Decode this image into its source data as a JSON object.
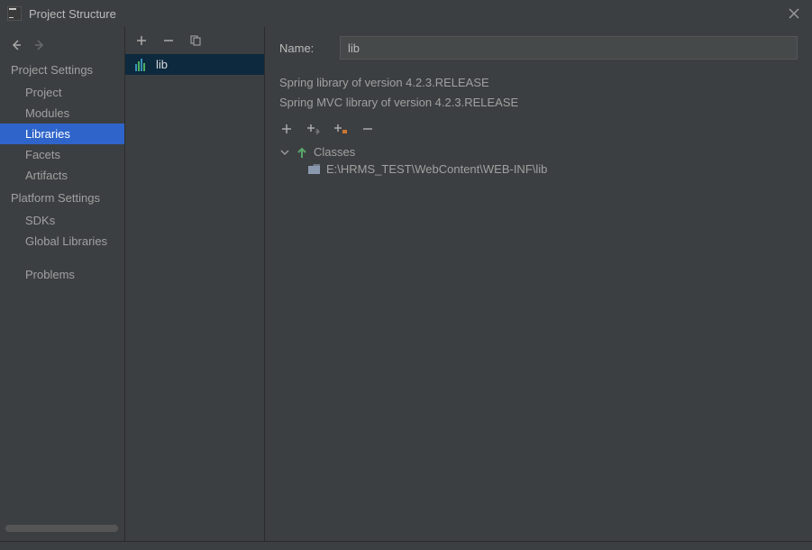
{
  "window": {
    "title": "Project Structure"
  },
  "sidebar": {
    "sections": [
      {
        "label": "Project Settings",
        "items": [
          {
            "label": "Project",
            "name": "nav-item-project"
          },
          {
            "label": "Modules",
            "name": "nav-item-modules"
          },
          {
            "label": "Libraries",
            "name": "nav-item-libraries",
            "selected": true
          },
          {
            "label": "Facets",
            "name": "nav-item-facets"
          },
          {
            "label": "Artifacts",
            "name": "nav-item-artifacts"
          }
        ]
      },
      {
        "label": "Platform Settings",
        "items": [
          {
            "label": "SDKs",
            "name": "nav-item-sdks"
          },
          {
            "label": "Global Libraries",
            "name": "nav-item-global-libraries"
          }
        ]
      }
    ],
    "problems": {
      "label": "Problems"
    }
  },
  "middle": {
    "items": [
      {
        "label": "lib",
        "selected": true
      }
    ]
  },
  "details": {
    "name_label": "Name:",
    "name_value": "lib",
    "info1": "Spring library of version 4.2.3.RELEASE",
    "info2": "Spring MVC library of version 4.2.3.RELEASE",
    "tree_root": "Classes",
    "tree_child": "E:\\HRMS_TEST\\WebContent\\WEB-INF\\lib"
  },
  "icons": {
    "plus": "+",
    "minus": "−",
    "arrow_left": "←",
    "arrow_right": "→"
  }
}
